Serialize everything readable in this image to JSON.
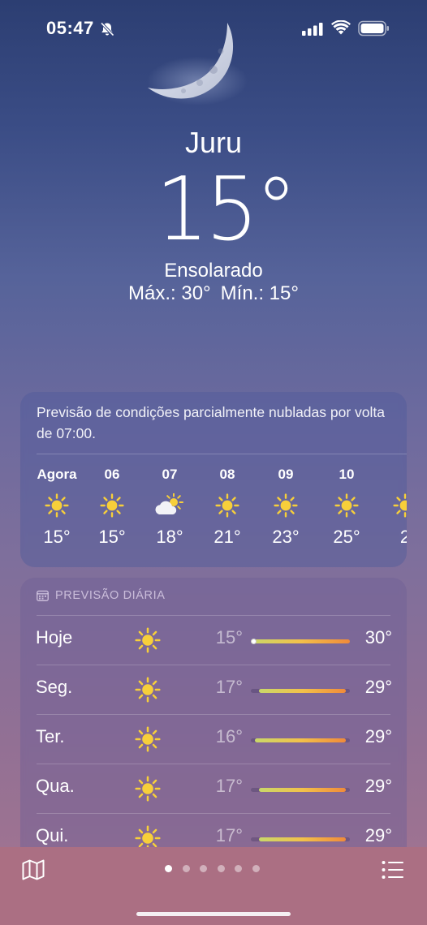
{
  "status": {
    "time": "05:47"
  },
  "location": "Juru",
  "current": {
    "temp": "15°",
    "condition": "Ensolarado",
    "high": "Máx.: 30°",
    "low": "Mín.: 15°"
  },
  "hourly": {
    "summary": "Previsão de condições parcialmente nubladas por volta de 07:00.",
    "items": [
      {
        "time": "Agora",
        "icon": "sun-icon",
        "temp": "15°"
      },
      {
        "time": "06",
        "icon": "sun-icon",
        "temp": "15°"
      },
      {
        "time": "07",
        "icon": "partly-cloudy-icon",
        "temp": "18°"
      },
      {
        "time": "08",
        "icon": "sun-icon",
        "temp": "21°"
      },
      {
        "time": "09",
        "icon": "sun-icon",
        "temp": "23°"
      },
      {
        "time": "10",
        "icon": "sun-icon",
        "temp": "25°"
      },
      {
        "time": "",
        "icon": "sun-icon",
        "temp": "2"
      }
    ]
  },
  "daily": {
    "header": "PREVISÃO DIÁRIA",
    "items": [
      {
        "day": "Hoje",
        "icon": "sun-icon",
        "low": "15°",
        "high": "30°",
        "range_start": 0.0,
        "range_end": 1.0,
        "current_marker": 0.0
      },
      {
        "day": "Seg.",
        "icon": "sun-icon",
        "low": "17°",
        "high": "29°",
        "range_start": 0.08,
        "range_end": 0.96
      },
      {
        "day": "Ter.",
        "icon": "sun-icon",
        "low": "16°",
        "high": "29°",
        "range_start": 0.04,
        "range_end": 0.96
      },
      {
        "day": "Qua.",
        "icon": "sun-icon",
        "low": "17°",
        "high": "29°",
        "range_start": 0.08,
        "range_end": 0.96
      },
      {
        "day": "Qui.",
        "icon": "sun-icon",
        "low": "17°",
        "high": "29°",
        "range_start": 0.08,
        "range_end": 0.96
      }
    ]
  },
  "pager": {
    "count": 6,
    "active": 0
  },
  "colors": {
    "sun": "#f7cf3a",
    "tabbar": "#ab6f83"
  }
}
